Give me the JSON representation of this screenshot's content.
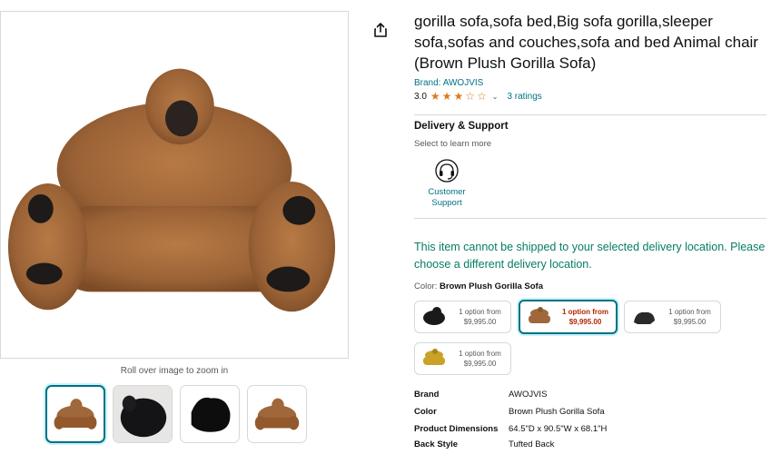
{
  "gallery": {
    "zoom_hint": "Roll over image to zoom in",
    "thumbnail_count": 4
  },
  "product": {
    "title": "gorilla sofa,sofa bed,Big sofa gorilla,sleeper sofa,sofas and couches,sofa and bed Animal chair (Brown Plush Gorilla Sofa)",
    "brand_link": "Brand: AWOJVIS",
    "rating_value": "3.0",
    "rating_stars": 3,
    "ratings_count": "3 ratings"
  },
  "delivery": {
    "title": "Delivery & Support",
    "subtitle": "Select to learn more",
    "support_label": "Customer Support"
  },
  "shipping_warning": "This item cannot be shipped to your selected delivery location. Please choose a different delivery location.",
  "color": {
    "label": "Color:",
    "selected": "Brown Plush Gorilla Sofa",
    "options": [
      {
        "line1": "1 option from",
        "line2": "$9,995.00",
        "tone": "#1a1a1a"
      },
      {
        "line1": "1 option from",
        "line2": "$9,995.00",
        "tone": "#a0673a"
      },
      {
        "line1": "1 option from",
        "line2": "$9,995.00",
        "tone": "#2a2a2a"
      },
      {
        "line1": "1 option from",
        "line2": "$9,995.00",
        "tone": "#c9a227"
      }
    ]
  },
  "specs": [
    {
      "key": "Brand",
      "value": "AWOJVIS"
    },
    {
      "key": "Color",
      "value": "Brown Plush Gorilla Sofa"
    },
    {
      "key": "Product Dimensions",
      "value": "64.5\"D x 90.5\"W x 68.1\"H"
    },
    {
      "key": "Back Style",
      "value": "Tufted Back"
    }
  ],
  "colors": {
    "link": "#007185",
    "success": "#067d62",
    "price_red": "#b12704",
    "star": "#de7921",
    "fur": "#a0673a"
  }
}
